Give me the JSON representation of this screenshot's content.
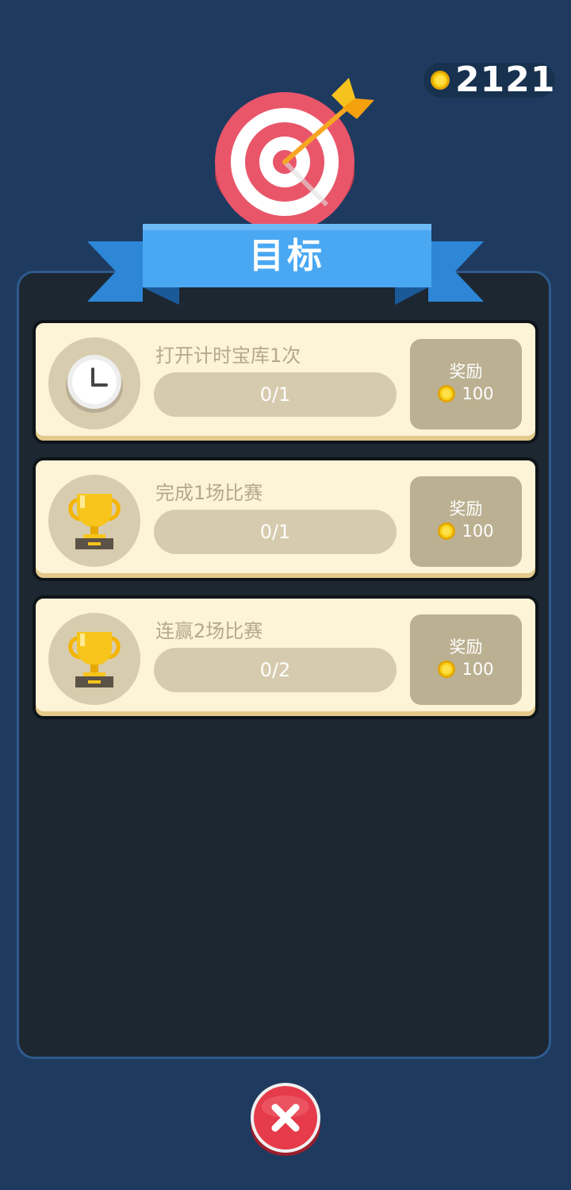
{
  "header": {
    "coin_balance": "2121",
    "coin_icon": "gold-coin-icon"
  },
  "title_banner": {
    "title": "目标",
    "emblem_icon": "target-arrow-icon"
  },
  "goals": [
    {
      "title": "打开计时宝库1次",
      "icon": "clock-icon",
      "progress_text": "0/1",
      "progress_fraction": 0,
      "reward_label": "奖励",
      "reward_amount": "100"
    },
    {
      "title": "完成1场比赛",
      "icon": "trophy-icon",
      "progress_text": "0/1",
      "progress_fraction": 0,
      "reward_label": "奖励",
      "reward_amount": "100"
    },
    {
      "title": "连赢2场比赛",
      "icon": "trophy-icon",
      "progress_text": "0/2",
      "progress_fraction": 0,
      "reward_label": "奖励",
      "reward_amount": "100"
    }
  ],
  "footer": {
    "close_icon": "close-x-icon"
  },
  "colors": {
    "background": "#1e3a5f",
    "panel": "#1c2731",
    "card": "#fdf3d6",
    "ribbon": "#4aa3f0",
    "coin": "#f4c20d",
    "close_button": "#e53b4a"
  }
}
